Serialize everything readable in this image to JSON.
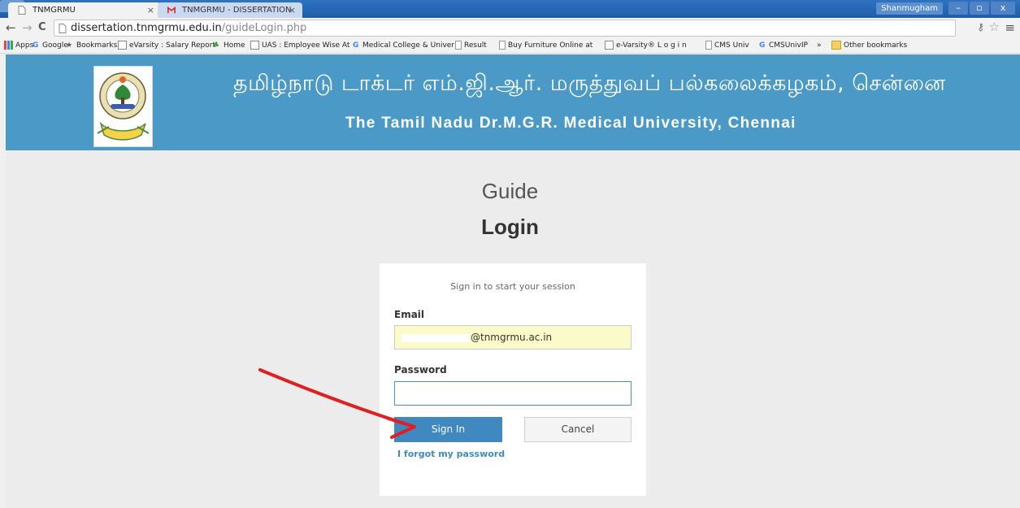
{
  "browser": {
    "tabs": [
      {
        "title": "TNMGRMU",
        "close": "×"
      },
      {
        "title": "TNMGRMU - DISSERTATION",
        "close": "×"
      }
    ],
    "user": "Shanmugham",
    "window_controls": {
      "minimize": "–",
      "maximize": "▫",
      "close": "x"
    },
    "url_host": "dissertation.tnmgrmu.edu.in",
    "url_path": "/guideLogin.php"
  },
  "bookmarks": [
    "Apps",
    "Google",
    "Bookmarks",
    "eVarsity : Salary Report",
    "Home",
    "UAS : Employee Wise At",
    "Medical College & Univer",
    "Result",
    "Buy Furniture Online at",
    "e-Varsity® L o g i n",
    "CMS Univ",
    "CMSUnivIP",
    "»",
    "Other bookmarks"
  ],
  "header": {
    "tamil_title": "தமிழ்நாடு டாக்டர் எம்.ஜி.ஆர். மருத்துவப் பல்கலைக்கழகம், சென்னை",
    "english_title": "The Tamil Nadu Dr.M.G.R. Medical University, Chennai"
  },
  "page": {
    "guide": "Guide",
    "login": "Login"
  },
  "form": {
    "message": "Sign in to start your session",
    "email_label": "Email",
    "email_value": "@tnmgrmu.ac.in",
    "password_label": "Password",
    "password_value": "",
    "signin_label": "Sign In",
    "cancel_label": "Cancel",
    "forgot_label": "I forgot my password"
  },
  "colors": {
    "header_blue": "#4a99c6",
    "button_blue": "#3f89c0",
    "autofill_yellow": "#fbfbc9",
    "arrow_red": "#e02020"
  }
}
